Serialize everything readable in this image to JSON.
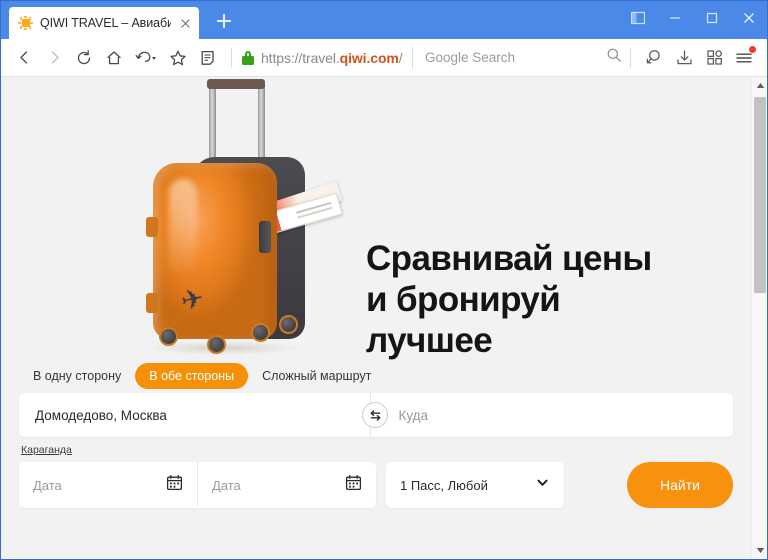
{
  "window": {
    "controls": {
      "panel": "panel-toggle",
      "minimize": "minimize",
      "maximize": "maximize",
      "close": "close"
    }
  },
  "tabs": {
    "active_tab_title": "QIWI TRAVEL – Авиаби",
    "favicon": "qiwi-sun-icon",
    "new_tab_label": "+"
  },
  "toolbar": {
    "back": "back-icon",
    "forward": "forward-icon",
    "reload": "reload-icon",
    "home": "home-icon",
    "undo": "undo-icon",
    "bookmark": "star-icon",
    "reading_list": "reading-list-icon",
    "url": {
      "scheme": "https://travel.",
      "domain": "qiwi.com",
      "path": "/"
    },
    "search_placeholder": "Google Search",
    "search_icon": "search-icon",
    "find_icon": "find-on-page-icon",
    "download_icon": "download-icon",
    "apps_icon": "apps-grid-icon",
    "menu_icon": "hamburger-menu-icon",
    "menu_badge": true
  },
  "page": {
    "hero": {
      "title": "Сравнивай цены\nи бронируй\nлучшее",
      "illustration": "orange-suitcase-with-tickets"
    },
    "trip_tabs": [
      {
        "label": "В одну сторону",
        "active": false
      },
      {
        "label": "В обе стороны",
        "active": true
      },
      {
        "label": "Сложный маршрут",
        "active": false
      }
    ],
    "search_form": {
      "origin_value": "Домодедово, Москва",
      "destination_placeholder": "Куда",
      "swap_icon": "swap-arrows-icon",
      "suggestion": "Караганда",
      "date_depart_placeholder": "Дата",
      "date_return_placeholder": "Дата",
      "calendar_icon": "calendar-icon",
      "passengers_value": "1 Пасс, Любой",
      "passengers_chevron": "chevron-down-icon",
      "search_button_label": "Найти"
    }
  },
  "colors": {
    "brand_orange": "#f7910e",
    "tab_strip_blue": "#4a89e8",
    "page_background": "#f2f2f2",
    "lock_green": "#34a116",
    "badge_red": "#f2392c"
  },
  "scrollbar": {
    "up_arrow": "scroll-up-icon",
    "down_arrow": "scroll-down-icon"
  }
}
